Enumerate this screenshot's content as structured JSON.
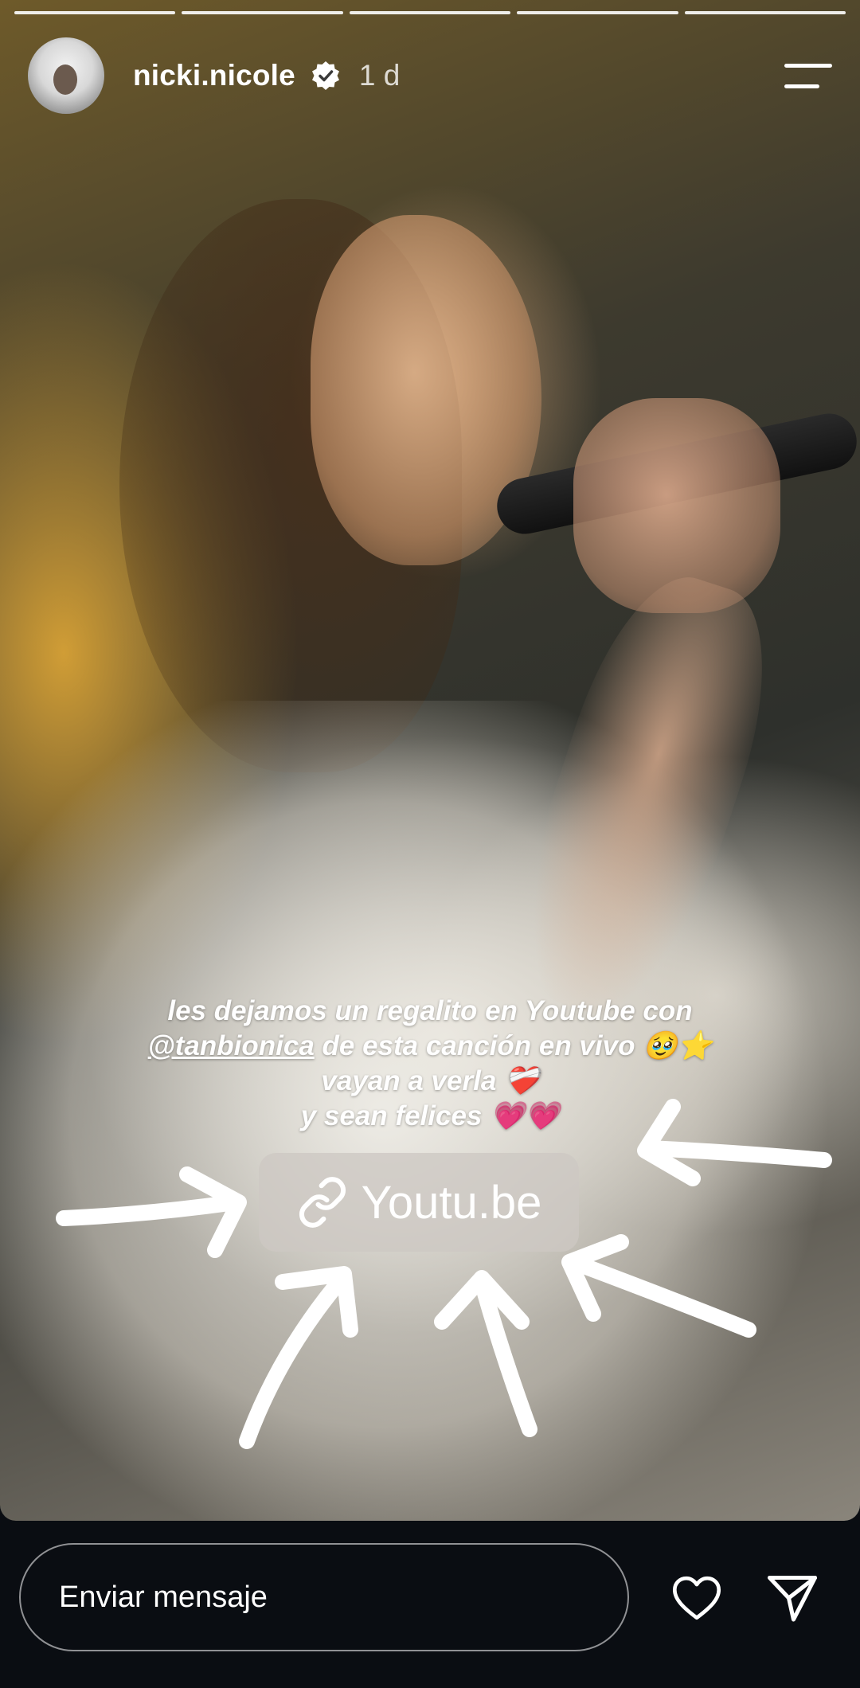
{
  "story": {
    "segments": 5,
    "username": "nicki.nicole",
    "time": "1 d",
    "caption": {
      "line1": "les dejamos un regalito en Youtube con",
      "mention": "@tanbionica",
      "line2_rest": " de esta canción en vivo 🥹⭐",
      "line3": "vayan a verla ❤️‍🩹",
      "line4": "y sean felices 💗💗"
    },
    "link_sticker": {
      "label": "Youtu.be"
    }
  },
  "bottom_bar": {
    "message_placeholder": "Enviar mensaje"
  }
}
